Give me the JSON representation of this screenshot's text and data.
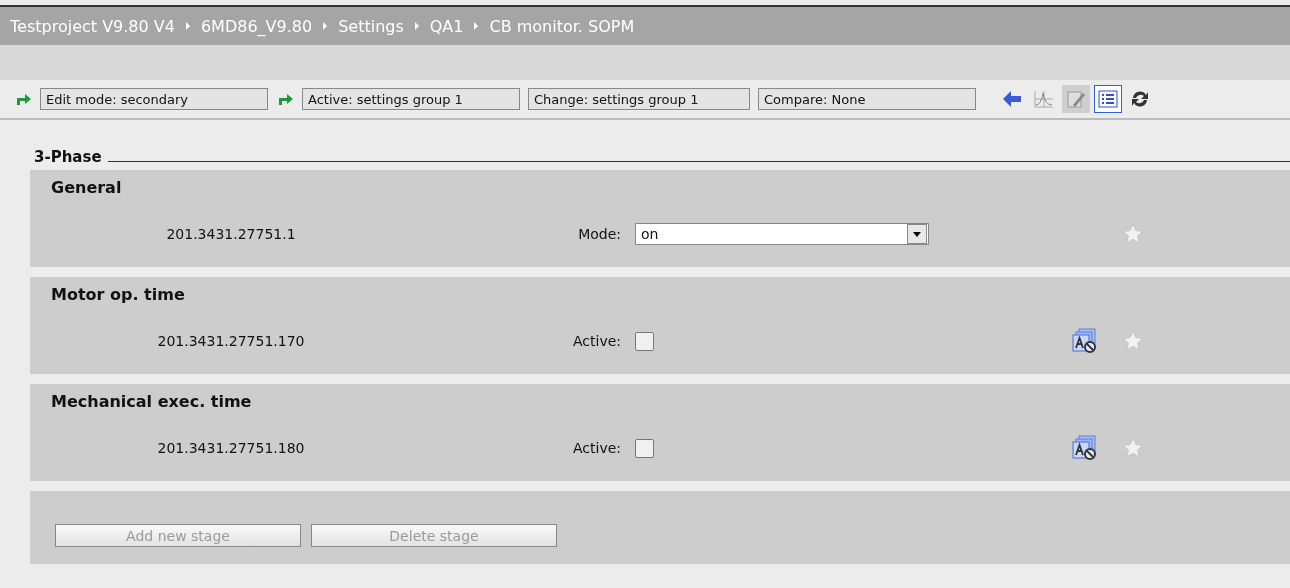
{
  "breadcrumb": [
    "Testproject V9.80 V4",
    "6MD86_V9.80",
    "Settings",
    "QA1",
    "CB monitor. SOPM"
  ],
  "toolbar": {
    "fields": [
      {
        "text": "Edit mode:  secondary",
        "arrow": true
      },
      {
        "text": "Active:  settings group 1",
        "arrow": true
      },
      {
        "text": "Change:  settings group 1",
        "arrow": false
      },
      {
        "text": "Compare:  None",
        "arrow": false
      }
    ],
    "tools": [
      {
        "kind": "back",
        "selected": false
      },
      {
        "kind": "chart",
        "selected": false
      },
      {
        "kind": "edit",
        "selected": false
      },
      {
        "kind": "list",
        "selected": true
      },
      {
        "kind": "refresh",
        "selected": false
      }
    ]
  },
  "group_title": "3-Phase",
  "sections": [
    {
      "title": "General",
      "id": "201.3431.27751.1",
      "label": "Mode:",
      "kind": "dropdown",
      "value": "on",
      "advanced": false
    },
    {
      "title": "Motor op. time",
      "id": "201.3431.27751.170",
      "label": "Active:",
      "kind": "checkbox",
      "checked": false,
      "advanced": true
    },
    {
      "title": "Mechanical exec. time",
      "id": "201.3431.27751.180",
      "label": "Active:",
      "kind": "checkbox",
      "checked": false,
      "advanced": true
    }
  ],
  "buttons": [
    {
      "label": "Add new stage",
      "disabled": true
    },
    {
      "label": "Delete stage",
      "disabled": true
    }
  ]
}
